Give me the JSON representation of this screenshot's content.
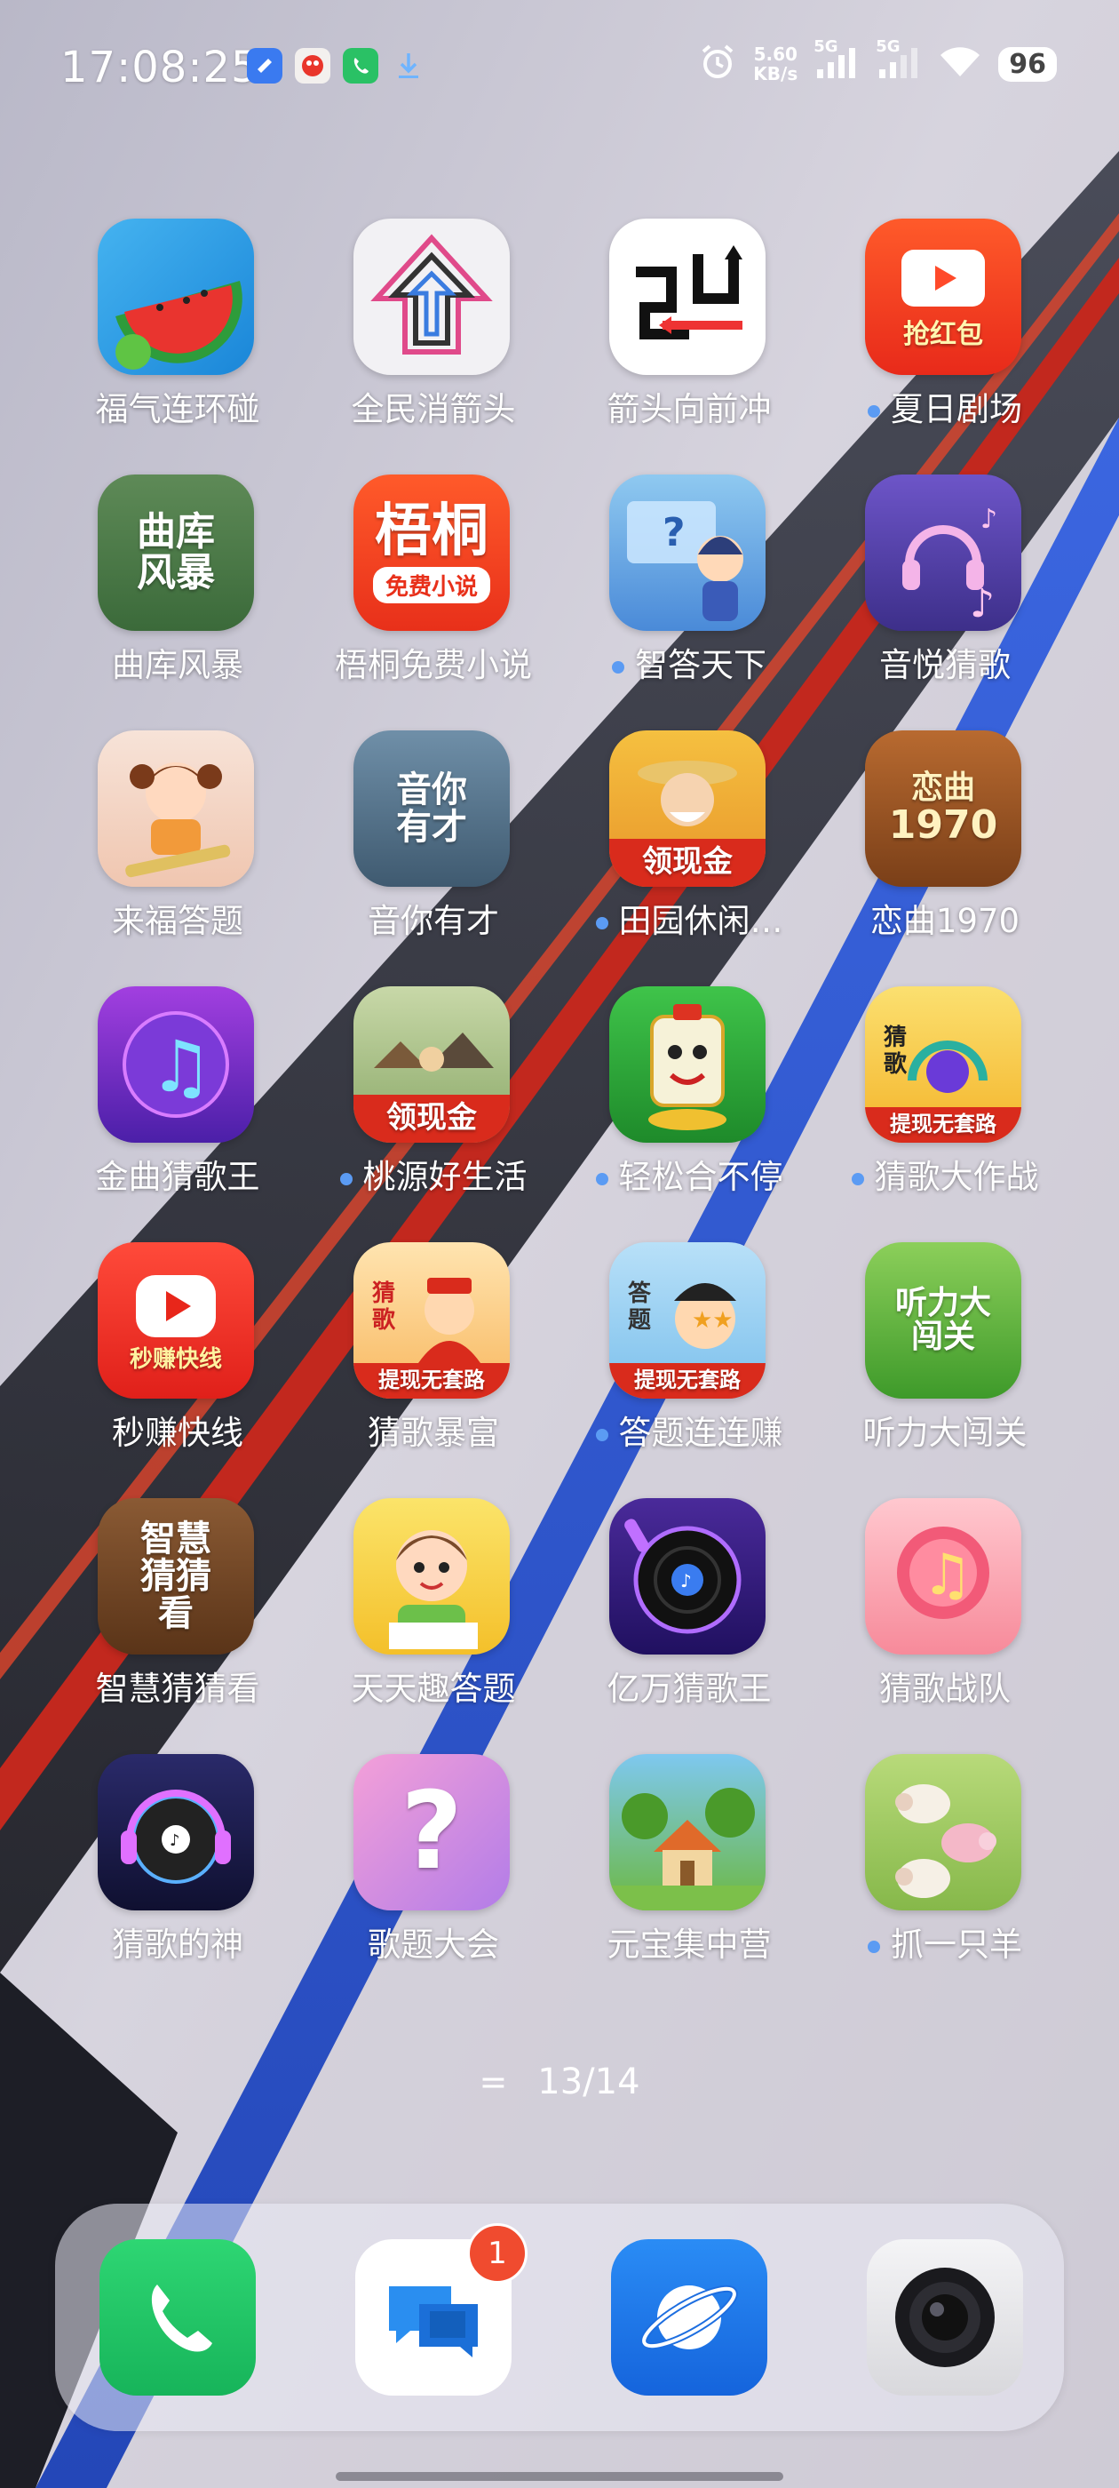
{
  "status_bar": {
    "time": "17:08:25",
    "net_speed_value": "5.60",
    "net_speed_unit": "KB/s",
    "sim1_label": "5G",
    "sim2_label": "5G",
    "battery": "96"
  },
  "apps": [
    {
      "label": "福气连环碰",
      "dot": false,
      "icon_text": ""
    },
    {
      "label": "全民消箭头",
      "dot": false,
      "icon_text": ""
    },
    {
      "label": "箭头向前冲",
      "dot": false,
      "icon_text": ""
    },
    {
      "label": "夏日剧场",
      "dot": true,
      "icon_text": "抢红包"
    },
    {
      "label": "曲库风暴",
      "dot": false,
      "icon_text": "曲库风暴"
    },
    {
      "label": "梧桐免费小说",
      "dot": false,
      "icon_text": "梧桐"
    },
    {
      "label": "智答天下",
      "dot": true,
      "icon_text": ""
    },
    {
      "label": "音悦猜歌",
      "dot": false,
      "icon_text": ""
    },
    {
      "label": "来福答题",
      "dot": false,
      "icon_text": ""
    },
    {
      "label": "音你有才",
      "dot": false,
      "icon_text": "音你有才"
    },
    {
      "label": "田园休闲…",
      "dot": true,
      "icon_text": "领现金"
    },
    {
      "label": "恋曲1970",
      "dot": false,
      "icon_text": "恋曲1970"
    },
    {
      "label": "金曲猜歌王",
      "dot": false,
      "icon_text": ""
    },
    {
      "label": "桃源好生活",
      "dot": true,
      "icon_text": "领现金"
    },
    {
      "label": "轻松合不停",
      "dot": true,
      "icon_text": ""
    },
    {
      "label": "猜歌大作战",
      "dot": true,
      "icon_text": "提现无套路"
    },
    {
      "label": "秒赚快线",
      "dot": false,
      "icon_text": "秒赚快线"
    },
    {
      "label": "猜歌暴富",
      "dot": false,
      "icon_text": "提现无套路"
    },
    {
      "label": "答题连连赚",
      "dot": true,
      "icon_text": "提现无套路"
    },
    {
      "label": "听力大闯关",
      "dot": false,
      "icon_text": "听力大闯关"
    },
    {
      "label": "智慧猜猜看",
      "dot": false,
      "icon_text": "智慧猜猜看"
    },
    {
      "label": "天天趣答题",
      "dot": false,
      "icon_text": ""
    },
    {
      "label": "亿万猜歌王",
      "dot": false,
      "icon_text": ""
    },
    {
      "label": "猜歌战队",
      "dot": false,
      "icon_text": ""
    },
    {
      "label": "猜歌的神",
      "dot": false,
      "icon_text": ""
    },
    {
      "label": "歌题大会",
      "dot": false,
      "icon_text": "?"
    },
    {
      "label": "元宝集中营",
      "dot": false,
      "icon_text": ""
    },
    {
      "label": "抓一只羊",
      "dot": true,
      "icon_text": ""
    }
  ],
  "icon_sub_texts": {
    "wutong_sub": "免费小说",
    "lianqu_sub": "1970"
  },
  "page_indicator": {
    "symbol": "=",
    "text": "13/14"
  },
  "dock": {
    "messages_badge": "1"
  },
  "colors": {
    "dot": "#5b9bf3",
    "badge": "#f04b2f",
    "phone": "#23c363",
    "browser": "#1e7cf2"
  }
}
